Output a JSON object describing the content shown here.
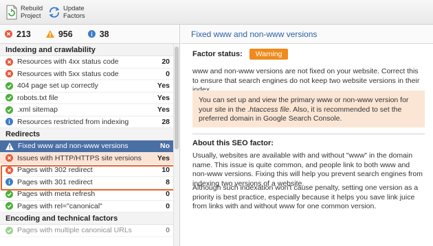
{
  "toolbar": {
    "rebuild_label_1": "Rebuild",
    "rebuild_label_2": "Project",
    "update_label_1": "Update",
    "update_label_2": "Factors"
  },
  "summary": {
    "errors": "213",
    "warnings": "956",
    "info": "38"
  },
  "sections": {
    "indexing": "Indexing and crawlability",
    "redirects": "Redirects",
    "encoding": "Encoding and technical factors"
  },
  "rows": [
    {
      "label": "Resources with 4xx status code",
      "value": "20",
      "status": "error"
    },
    {
      "label": "Resources with 5xx status code",
      "value": "0",
      "status": "error"
    },
    {
      "label": "404 page set up correctly",
      "value": "Yes",
      "status": "ok"
    },
    {
      "label": "robots.txt file",
      "value": "Yes",
      "status": "ok"
    },
    {
      "label": ".xml sitemap",
      "value": "Yes",
      "status": "ok"
    },
    {
      "label": "Resources restricted from indexing",
      "value": "28",
      "status": "info"
    },
    {
      "label": "Fixed www and non-www versions",
      "value": "No",
      "status": "warning"
    },
    {
      "label": "Issues with HTTP/HTTPS site versions",
      "value": "Yes",
      "status": "error"
    },
    {
      "label": "Pages with 302 redirect",
      "value": "10",
      "status": "error"
    },
    {
      "label": "Pages with 301 redirect",
      "value": "8",
      "status": "info"
    },
    {
      "label": "Pages with meta refresh",
      "value": "0",
      "status": "ok"
    },
    {
      "label": "Pages with rel=\"canonical\"",
      "value": "0",
      "status": "ok"
    },
    {
      "label": "Pages with multiple canonical URLs",
      "value": "0",
      "status": "ok"
    }
  ],
  "detail": {
    "title": "Fixed www and non-www versions",
    "factor_label": "Factor status:",
    "status_badge": "Warning",
    "para1": "www and non-www versions are not fixed on your website. Correct this to ensure that search engines do not keep two website versions in their index.",
    "note_a": "You can set up and view the primary www or non-www version for your site in the ",
    "note_em": ".htaccess file",
    "note_b": ". Also, it is recommended to set the preferred domain in Google Search Console.",
    "about_title": "About this SEO factor:",
    "para2": "Usually, websites are available with and without \"www\" in the domain name. This issue is quite common, and people link to both www and non-www versions. Fixing this will help you prevent search engines from indexing two versions of a website.",
    "para3": "Although such indexation won't cause penalty, setting one version as a priority is best practice, especially because it helps you save link juice from links with and without www for one common version."
  },
  "colors": {
    "error": "#e8593a",
    "warning": "#f29a1c",
    "ok": "#4caf3a",
    "info": "#3d7cc9",
    "accent": "#2a61a8",
    "highlight_frame": "#e8622a"
  }
}
